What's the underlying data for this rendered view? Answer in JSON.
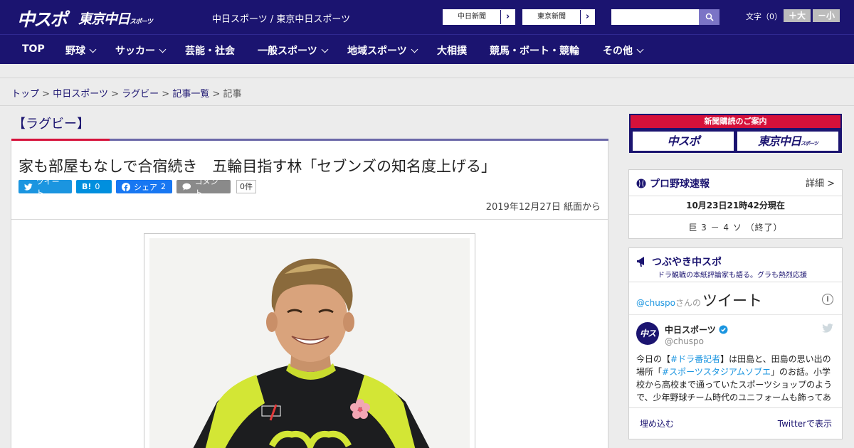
{
  "header": {
    "logo_chuspo": "中スポ",
    "logo_tokyo": "東京中日",
    "logo_tokyo_small": "スポーツ",
    "tagline": "中日スポーツ / 東京中日スポーツ",
    "paper_links": [
      "中日新聞",
      "東京新聞"
    ],
    "search_placeholder": "",
    "font_size_label": "文字（0）",
    "font_larger": "＋大",
    "font_smaller": "－小"
  },
  "nav": {
    "items": [
      {
        "label": "TOP",
        "has_menu": false
      },
      {
        "label": "野球",
        "has_menu": true
      },
      {
        "label": "サッカー",
        "has_menu": true
      },
      {
        "label": "芸能・社会",
        "has_menu": false
      },
      {
        "label": "一般スポーツ",
        "has_menu": true
      },
      {
        "label": "地域スポーツ",
        "has_menu": true
      },
      {
        "label": "大相撲",
        "has_menu": false
      },
      {
        "label": "競馬・ボート・競輪",
        "has_menu": false
      },
      {
        "label": "その他",
        "has_menu": true
      }
    ]
  },
  "breadcrumb": {
    "links": [
      "トップ",
      "中日スポーツ",
      "ラグビー",
      "記事一覧"
    ],
    "current": "記事",
    "separator": ">"
  },
  "article": {
    "category": "【ラグビー】",
    "headline": "家も部屋もなしで合宿続き　五輪目指す林「セブンズの知名度上げる」",
    "share": {
      "tweet": "ツイート",
      "hatena": "B!",
      "hatena_count": "0",
      "facebook": "シェア",
      "facebook_count": "2",
      "comment": "コメント",
      "comment_count": "0件"
    },
    "dateline": "2019年12月27日 紙面から"
  },
  "sidebar": {
    "ad": {
      "title": "新聞購読のご案内",
      "left": "中スポ",
      "right": "東京中日",
      "right_small": "スポーツ"
    },
    "baseball": {
      "title": "プロ野球速報",
      "detail": "詳細 >",
      "time": "10月23日21時42分現在",
      "score": "巨 3 － 4 ソ （終了）"
    },
    "tweets": {
      "title": "つぶやき中スポ",
      "subtitle": "ドラ観戦の本紙評論家も語る。グラも熱烈応援",
      "handle_link": "@chuspo",
      "handle_suffix": "さんの",
      "heading": "ツイート",
      "account_name": "中日スポーツ",
      "account_handle": "@chuspo",
      "avatar_text": "中スポ",
      "text_before": "今日の【",
      "tag1": "#ドラ番記者",
      "text_mid1": "】は田島と、田島の思い出の場所「",
      "tag2": "#スポーツスタジアムソブエ",
      "text_after": "」のお話。小学校から高校まで通っていたスポーツショップのようで、少年野球チーム時代のユニフォームも飾ってあ",
      "embed": "埋め込む",
      "view": "Twitterで表示"
    }
  },
  "colors": {
    "navy": "#1b1470",
    "accent_red": "#d6113a",
    "twitter_blue": "#1b95e0"
  }
}
